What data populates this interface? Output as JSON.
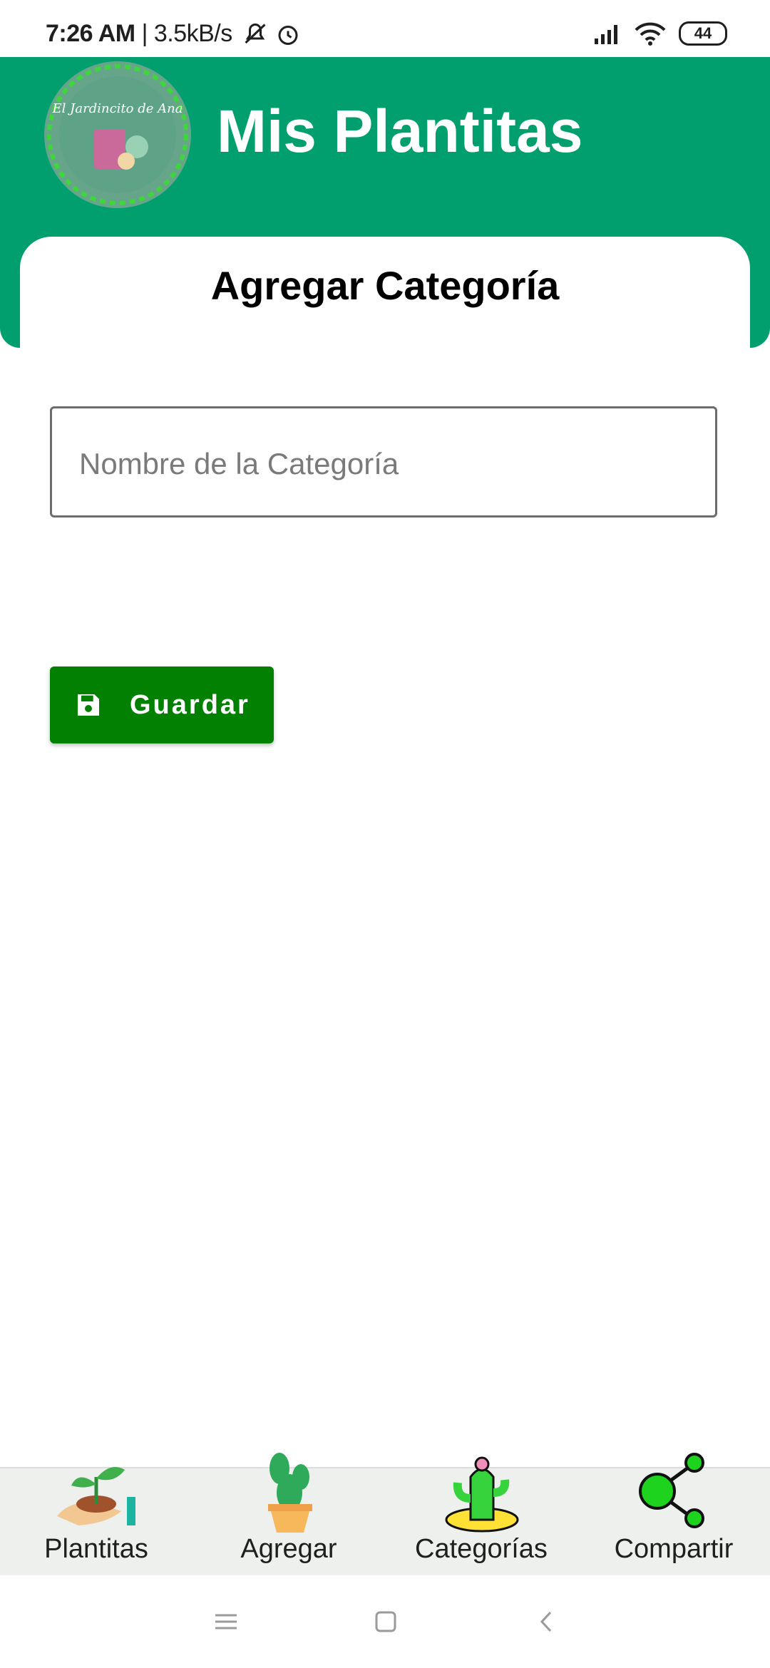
{
  "status_bar": {
    "time": "7:26 AM",
    "speed": "| 3.5kB/s",
    "battery": "44"
  },
  "header": {
    "app_title": "Mis Plantitas",
    "logo_text": "El Jardincito de Ana"
  },
  "page": {
    "title": "Agregar Categoría"
  },
  "form": {
    "category_placeholder": "Nombre de la Categoría",
    "category_value": ""
  },
  "buttons": {
    "save_label": "Guardar"
  },
  "bottom_nav": {
    "items": [
      {
        "label": "Plantitas",
        "icon": "hand-sprout-icon"
      },
      {
        "label": "Agregar",
        "icon": "potted-cactus-icon"
      },
      {
        "label": "Categorías",
        "icon": "cactus-flower-icon"
      },
      {
        "label": "Compartir",
        "icon": "share-icon"
      }
    ]
  },
  "colors": {
    "header_green": "#019f6d",
    "button_green": "#018001",
    "nav_background": "#eef0ee"
  }
}
